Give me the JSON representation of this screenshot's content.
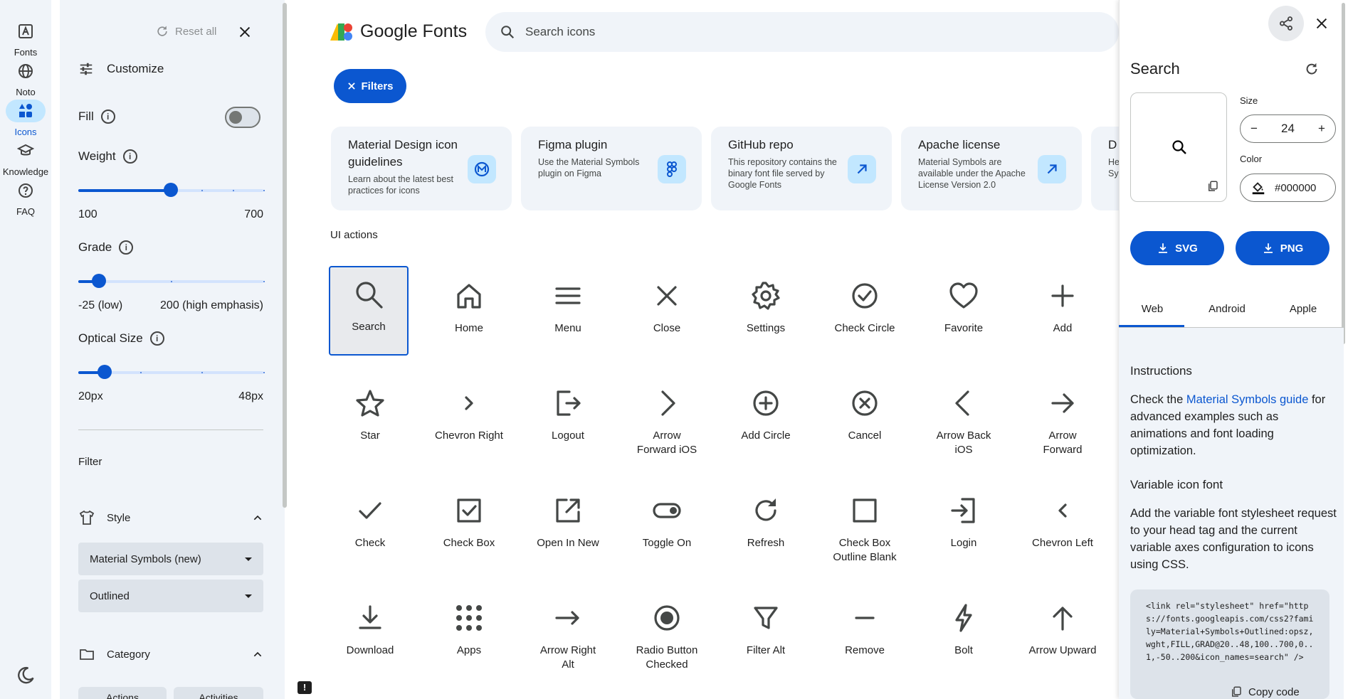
{
  "rail": {
    "items": [
      {
        "label": "Fonts",
        "icon": "fonts-icon"
      },
      {
        "label": "Noto",
        "icon": "globe-icon"
      },
      {
        "label": "Icons",
        "icon": "icons-icon"
      },
      {
        "label": "Knowledge",
        "icon": "knowledge-icon"
      },
      {
        "label": "FAQ",
        "icon": "help-icon"
      }
    ]
  },
  "sidebar": {
    "reset_label": "Reset all",
    "customize_label": "Customize",
    "fill_label": "Fill",
    "fill_on": false,
    "weight": {
      "label": "Weight",
      "min": "100",
      "max": "700",
      "value": 400
    },
    "grade": {
      "label": "Grade",
      "min": "-25 (low)",
      "max": "200 (high emphasis)",
      "value": 0
    },
    "optical": {
      "label": "Optical Size",
      "min": "20px",
      "max": "48px",
      "value": 24
    },
    "filter_label": "Filter",
    "style_label": "Style",
    "style_family": "Material Symbols (new)",
    "style_variant": "Outlined",
    "category_label": "Category",
    "category_chips": [
      "Actions",
      "Activities"
    ]
  },
  "header": {
    "logo_text": "Google Fonts",
    "search_placeholder": "Search icons",
    "filters_label": "Filters"
  },
  "cards": [
    {
      "title": "Material Design icon guidelines",
      "desc": "Learn about the latest best practices for icons",
      "icon": "material-logo-icon"
    },
    {
      "title": "Figma plugin",
      "desc": "Use the Material Symbols plugin on Figma",
      "icon": "figma-icon"
    },
    {
      "title": "GitHub repo",
      "desc": "This repository contains the binary font file served by Google Fonts",
      "icon": "arrow-outward-icon"
    },
    {
      "title": "Apache license",
      "desc": "Material Symbols are available under the Apache License Version 2.0",
      "icon": "arrow-outward-icon"
    },
    {
      "title": "D",
      "desc": "He Sy",
      "icon": ""
    }
  ],
  "section_title": "UI actions",
  "icons": [
    {
      "label": "Search",
      "name": "search"
    },
    {
      "label": "Home",
      "name": "home"
    },
    {
      "label": "Menu",
      "name": "menu"
    },
    {
      "label": "Close",
      "name": "close"
    },
    {
      "label": "Settings",
      "name": "settings"
    },
    {
      "label": "Check Circle",
      "name": "check-circle"
    },
    {
      "label": "Favorite",
      "name": "favorite"
    },
    {
      "label": "Add",
      "name": "add"
    },
    {
      "label": "Star",
      "name": "star"
    },
    {
      "label": "Chevron Right",
      "name": "chevron-right"
    },
    {
      "label": "Logout",
      "name": "logout"
    },
    {
      "label": "Arrow Forward iOS",
      "name": "arrow-forward-ios"
    },
    {
      "label": "Add Circle",
      "name": "add-circle"
    },
    {
      "label": "Cancel",
      "name": "cancel"
    },
    {
      "label": "Arrow Back iOS",
      "name": "arrow-back-ios"
    },
    {
      "label": "Arrow Forward",
      "name": "arrow-forward"
    },
    {
      "label": "Check",
      "name": "check"
    },
    {
      "label": "Check Box",
      "name": "check-box"
    },
    {
      "label": "Open In New",
      "name": "open-in-new"
    },
    {
      "label": "Toggle On",
      "name": "toggle-on"
    },
    {
      "label": "Refresh",
      "name": "refresh"
    },
    {
      "label": "Check Box Outline Blank",
      "name": "check-box-outline-blank"
    },
    {
      "label": "Login",
      "name": "login"
    },
    {
      "label": "Chevron Left",
      "name": "chevron-left"
    },
    {
      "label": "Download",
      "name": "download"
    },
    {
      "label": "Apps",
      "name": "apps"
    },
    {
      "label": "Arrow Right Alt",
      "name": "arrow-right-alt"
    },
    {
      "label": "Radio Button Checked",
      "name": "radio-button-checked"
    },
    {
      "label": "Filter Alt",
      "name": "filter-alt"
    },
    {
      "label": "Remove",
      "name": "remove"
    },
    {
      "label": "Bolt",
      "name": "bolt"
    },
    {
      "label": "Arrow Upward",
      "name": "arrow-upward"
    }
  ],
  "panel": {
    "title": "Search",
    "size_label": "Size",
    "size_value": "24",
    "color_label": "Color",
    "color_value": "#000000",
    "svg_label": "SVG",
    "png_label": "PNG",
    "tabs": [
      "Web",
      "Android",
      "Apple"
    ],
    "active_tab": "Web",
    "instructions_title": "Instructions",
    "instructions_pre": "Check the ",
    "instructions_link": "Material Symbols guide",
    "instructions_post": " for advanced examples such as animations and font loading optimization.",
    "variable_title": "Variable icon font",
    "variable_text": "Add the variable font stylesheet request to your head tag and the current variable axes configuration to icons using CSS.",
    "code": "<link rel=\"stylesheet\" href=\"https://fonts.googleapis.com/css2?family=Material+Symbols+Outlined:opsz,wght,FILL,GRAD@20..48,100..700,0..1,-50..200&icon_names=search\" />",
    "copy_label": "Copy code"
  },
  "colors": {
    "accent": "#0b57d0",
    "surface": "#f0f4f9",
    "chip": "#c2e7ff"
  }
}
